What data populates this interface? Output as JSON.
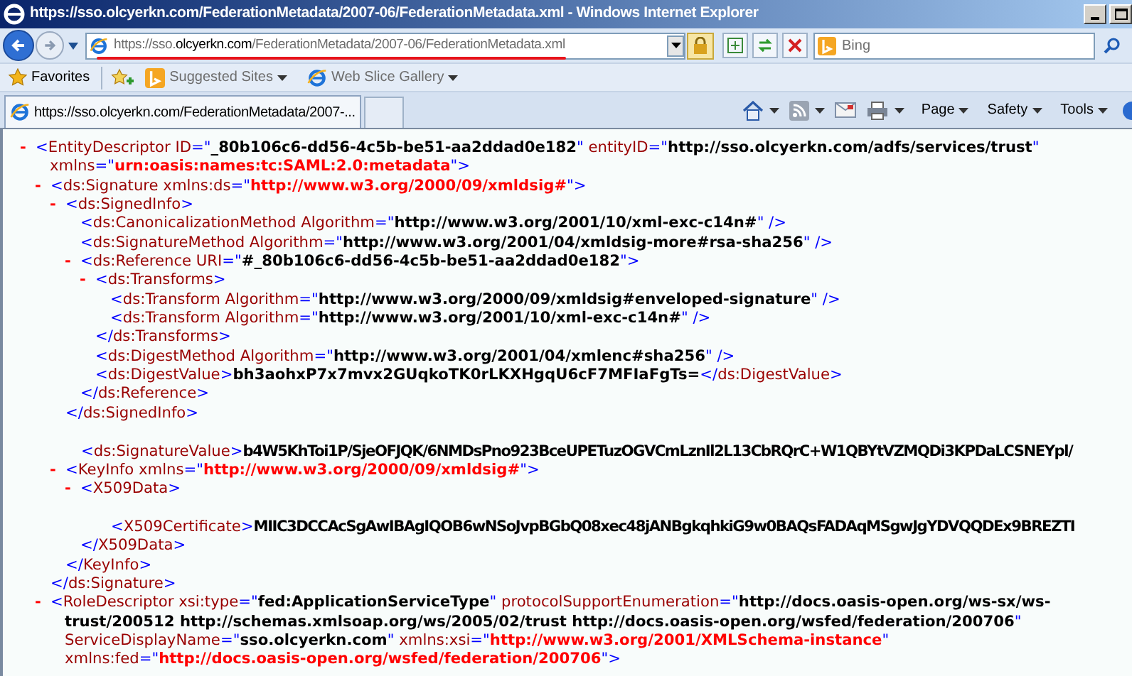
{
  "window": {
    "title": "https://sso.olcyerkn.com/FederationMetadata/2007-06/FederationMetadata.xml - Windows Internet Explorer"
  },
  "address_bar": {
    "url_parts": [
      {
        "text": "https://sso.",
        "emphasis": false
      },
      {
        "text": "olcyerkn.com",
        "emphasis": true
      },
      {
        "text": "/FederationMetadata/2007-06/FederationMetadata.xml",
        "emphasis": false
      }
    ]
  },
  "search": {
    "placeholder": "Bing"
  },
  "favorites_bar": {
    "favorites": "Favorites",
    "items": [
      {
        "label": "Suggested Sites"
      },
      {
        "label": "Web Slice Gallery"
      }
    ]
  },
  "tabs": [
    {
      "label": "https://sso.olcyerkn.com/FederationMetadata/2007-...",
      "selected": true
    }
  ],
  "command_bar": [
    "Page",
    "Safety",
    "Tools"
  ],
  "document": {
    "nodes": [
      {
        "kind": "element",
        "toggle": "-",
        "lines": [
          [
            {
              "kind": "p",
              "text": "<"
            },
            {
              "kind": "tag",
              "text": "EntityDescriptor"
            },
            {
              "kind": "attr",
              "text": " ID"
            },
            {
              "kind": "p",
              "text": "=\""
            },
            {
              "kind": "val",
              "text": "_80b106c6-dd56-4c5b-be51-aa2ddad0e182"
            },
            {
              "kind": "p",
              "text": "\""
            },
            {
              "kind": "attr",
              "text": " entityID"
            },
            {
              "kind": "p",
              "text": "=\""
            },
            {
              "kind": "val",
              "text": "http://sso.olcyerkn.com/adfs/services/trust"
            },
            {
              "kind": "p",
              "text": "\""
            }
          ],
          [
            {
              "kind": "attr",
              "text": "xmlns"
            },
            {
              "kind": "p",
              "text": "=\""
            },
            {
              "kind": "ns",
              "text": "urn:oasis:names:tc:SAML:2.0:metadata"
            },
            {
              "kind": "p",
              "text": "\">"
            }
          ]
        ],
        "children": [
          {
            "kind": "element",
            "toggle": "-",
            "lines": [
              [
                {
                  "kind": "p",
                  "text": "<"
                },
                {
                  "kind": "tag",
                  "text": "ds:Signature"
                },
                {
                  "kind": "attr",
                  "text": " xmlns:ds"
                },
                {
                  "kind": "p",
                  "text": "=\""
                },
                {
                  "kind": "ns",
                  "text": "http://www.w3.org/2000/09/xmldsig#"
                },
                {
                  "kind": "p",
                  "text": "\">"
                }
              ]
            ],
            "children": [
              {
                "kind": "element",
                "toggle": "-",
                "lines": [
                  [
                    {
                      "kind": "p",
                      "text": "<"
                    },
                    {
                      "kind": "tag",
                      "text": "ds:SignedInfo"
                    },
                    {
                      "kind": "p",
                      "text": ">"
                    }
                  ]
                ],
                "children": [
                  {
                    "kind": "leaf",
                    "lines": [
                      [
                        {
                          "kind": "p",
                          "text": "<"
                        },
                        {
                          "kind": "tag",
                          "text": "ds:CanonicalizationMethod"
                        },
                        {
                          "kind": "attr",
                          "text": " Algorithm"
                        },
                        {
                          "kind": "p",
                          "text": "=\""
                        },
                        {
                          "kind": "val",
                          "text": "http://www.w3.org/2001/10/xml-exc-c14n#"
                        },
                        {
                          "kind": "p",
                          "text": "\" />"
                        }
                      ]
                    ]
                  },
                  {
                    "kind": "leaf",
                    "lines": [
                      [
                        {
                          "kind": "p",
                          "text": "<"
                        },
                        {
                          "kind": "tag",
                          "text": "ds:SignatureMethod"
                        },
                        {
                          "kind": "attr",
                          "text": " Algorithm"
                        },
                        {
                          "kind": "p",
                          "text": "=\""
                        },
                        {
                          "kind": "val",
                          "text": "http://www.w3.org/2001/04/xmldsig-more#rsa-sha256"
                        },
                        {
                          "kind": "p",
                          "text": "\" />"
                        }
                      ]
                    ]
                  },
                  {
                    "kind": "element",
                    "toggle": "-",
                    "lines": [
                      [
                        {
                          "kind": "p",
                          "text": "<"
                        },
                        {
                          "kind": "tag",
                          "text": "ds:Reference"
                        },
                        {
                          "kind": "attr",
                          "text": " URI"
                        },
                        {
                          "kind": "p",
                          "text": "=\""
                        },
                        {
                          "kind": "val",
                          "text": "#_80b106c6-dd56-4c5b-be51-aa2ddad0e182"
                        },
                        {
                          "kind": "p",
                          "text": "\">"
                        }
                      ]
                    ],
                    "children": [
                      {
                        "kind": "element",
                        "toggle": "-",
                        "lines": [
                          [
                            {
                              "kind": "p",
                              "text": "<"
                            },
                            {
                              "kind": "tag",
                              "text": "ds:Transforms"
                            },
                            {
                              "kind": "p",
                              "text": ">"
                            }
                          ]
                        ],
                        "children": [
                          {
                            "kind": "leaf",
                            "lines": [
                              [
                                {
                                  "kind": "p",
                                  "text": "<"
                                },
                                {
                                  "kind": "tag",
                                  "text": "ds:Transform"
                                },
                                {
                                  "kind": "attr",
                                  "text": " Algorithm"
                                },
                                {
                                  "kind": "p",
                                  "text": "=\""
                                },
                                {
                                  "kind": "val",
                                  "text": "http://www.w3.org/2000/09/xmldsig#enveloped-signature"
                                },
                                {
                                  "kind": "p",
                                  "text": "\" />"
                                }
                              ]
                            ]
                          },
                          {
                            "kind": "leaf",
                            "lines": [
                              [
                                {
                                  "kind": "p",
                                  "text": "<"
                                },
                                {
                                  "kind": "tag",
                                  "text": "ds:Transform"
                                },
                                {
                                  "kind": "attr",
                                  "text": " Algorithm"
                                },
                                {
                                  "kind": "p",
                                  "text": "=\""
                                },
                                {
                                  "kind": "val",
                                  "text": "http://www.w3.org/2001/10/xml-exc-c14n#"
                                },
                                {
                                  "kind": "p",
                                  "text": "\" />"
                                }
                              ]
                            ]
                          }
                        ],
                        "close": [
                          {
                            "kind": "p",
                            "text": "</"
                          },
                          {
                            "kind": "tag",
                            "text": "ds:Transforms"
                          },
                          {
                            "kind": "p",
                            "text": ">"
                          }
                        ]
                      },
                      {
                        "kind": "leaf",
                        "lines": [
                          [
                            {
                              "kind": "p",
                              "text": "<"
                            },
                            {
                              "kind": "tag",
                              "text": "ds:DigestMethod"
                            },
                            {
                              "kind": "attr",
                              "text": " Algorithm"
                            },
                            {
                              "kind": "p",
                              "text": "=\""
                            },
                            {
                              "kind": "val",
                              "text": "http://www.w3.org/2001/04/xmlenc#sha256"
                            },
                            {
                              "kind": "p",
                              "text": "\" />"
                            }
                          ]
                        ]
                      },
                      {
                        "kind": "leaf",
                        "lines": [
                          [
                            {
                              "kind": "p",
                              "text": "<"
                            },
                            {
                              "kind": "tag",
                              "text": "ds:DigestValue"
                            },
                            {
                              "kind": "p",
                              "text": ">"
                            },
                            {
                              "kind": "val",
                              "text": "bh3aohxP7x7mvx2GUqkoTK0rLKXHgqU6cF7MFIaFgTs="
                            },
                            {
                              "kind": "p",
                              "text": "</"
                            },
                            {
                              "kind": "tag",
                              "text": "ds:DigestValue"
                            },
                            {
                              "kind": "p",
                              "text": ">"
                            }
                          ]
                        ]
                      }
                    ],
                    "close": [
                      {
                        "kind": "p",
                        "text": "</"
                      },
                      {
                        "kind": "tag",
                        "text": "ds:Reference"
                      },
                      {
                        "kind": "p",
                        "text": ">"
                      }
                    ]
                  }
                ],
                "close": [
                  {
                    "kind": "p",
                    "text": "</"
                  },
                  {
                    "kind": "tag",
                    "text": "ds:SignedInfo"
                  },
                  {
                    "kind": "p",
                    "text": ">"
                  }
                ]
              },
              {
                "kind": "text_element",
                "lines": [
                  [
                    {
                      "kind": "p",
                      "text": "<"
                    },
                    {
                      "kind": "tag",
                      "text": "ds:SignatureValue"
                    },
                    {
                      "kind": "p",
                      "text": ">"
                    },
                    {
                      "kind": "val",
                      "text": "b4W5KhToi1P/SjeOFJQK/6NMDsPno923BceUPETuzOGVCmLznIl2L13CbRQrC+W1QBYtVZMQDi3KPDaLCSNEYpl/"
                    }
                  ]
                ]
              },
              {
                "kind": "element",
                "toggle": "-",
                "lines": [
                  [
                    {
                      "kind": "p",
                      "text": "<"
                    },
                    {
                      "kind": "tag",
                      "text": "KeyInfo"
                    },
                    {
                      "kind": "attr",
                      "text": " xmlns"
                    },
                    {
                      "kind": "p",
                      "text": "=\""
                    },
                    {
                      "kind": "ns",
                      "text": "http://www.w3.org/2000/09/xmldsig#"
                    },
                    {
                      "kind": "p",
                      "text": "\">"
                    }
                  ]
                ],
                "children": [
                  {
                    "kind": "element",
                    "toggle": "-",
                    "lines": [
                      [
                        {
                          "kind": "p",
                          "text": "<"
                        },
                        {
                          "kind": "tag",
                          "text": "X509Data"
                        },
                        {
                          "kind": "p",
                          "text": ">"
                        }
                      ]
                    ],
                    "children": [
                      {
                        "kind": "text_element",
                        "lines": [
                          [
                            {
                              "kind": "p",
                              "text": "<"
                            },
                            {
                              "kind": "tag",
                              "text": "X509Certificate"
                            },
                            {
                              "kind": "p",
                              "text": ">"
                            },
                            {
                              "kind": "val",
                              "text": "MIIC3DCCAcSgAwIBAgIQOB6wNSoJvpBGbQ08xec48jANBgkqhkiG9w0BAQsFADAqMSgwJgYDVQQDEx9BREZTI"
                            }
                          ]
                        ]
                      }
                    ],
                    "close": [
                      {
                        "kind": "p",
                        "text": "</"
                      },
                      {
                        "kind": "tag",
                        "text": "X509Data"
                      },
                      {
                        "kind": "p",
                        "text": ">"
                      }
                    ]
                  }
                ],
                "close": [
                  {
                    "kind": "p",
                    "text": "</"
                  },
                  {
                    "kind": "tag",
                    "text": "KeyInfo"
                  },
                  {
                    "kind": "p",
                    "text": ">"
                  }
                ]
              }
            ],
            "close": [
              {
                "kind": "p",
                "text": "</"
              },
              {
                "kind": "tag",
                "text": "ds:Signature"
              },
              {
                "kind": "p",
                "text": ">"
              }
            ]
          },
          {
            "kind": "element",
            "toggle": "-",
            "lines": [
              [
                {
                  "kind": "p",
                  "text": "<"
                },
                {
                  "kind": "tag",
                  "text": "RoleDescriptor"
                },
                {
                  "kind": "attr",
                  "text": " xsi:type"
                },
                {
                  "kind": "p",
                  "text": "=\""
                },
                {
                  "kind": "val",
                  "text": "fed:ApplicationServiceType"
                },
                {
                  "kind": "p",
                  "text": "\""
                },
                {
                  "kind": "attr",
                  "text": " protocolSupportEnumeration"
                },
                {
                  "kind": "p",
                  "text": "=\""
                },
                {
                  "kind": "val",
                  "text": "http://docs.oasis-open.org/ws-sx/ws-"
                }
              ],
              [
                {
                  "kind": "val",
                  "text": "trust/200512 http://schemas.xmlsoap.org/ws/2005/02/trust http://docs.oasis-open.org/wsfed/federation/200706"
                },
                {
                  "kind": "p",
                  "text": "\""
                }
              ],
              [
                {
                  "kind": "attr",
                  "text": "ServiceDisplayName"
                },
                {
                  "kind": "p",
                  "text": "=\""
                },
                {
                  "kind": "val",
                  "text": "sso.olcyerkn.com"
                },
                {
                  "kind": "p",
                  "text": "\""
                },
                {
                  "kind": "attr",
                  "text": " xmlns:xsi"
                },
                {
                  "kind": "p",
                  "text": "=\""
                },
                {
                  "kind": "ns",
                  "text": "http://www.w3.org/2001/XMLSchema-instance"
                },
                {
                  "kind": "p",
                  "text": "\""
                }
              ],
              [
                {
                  "kind": "attr",
                  "text": "xmlns:fed"
                },
                {
                  "kind": "p",
                  "text": "=\""
                },
                {
                  "kind": "ns",
                  "text": "http://docs.oasis-open.org/wsfed/federation/200706"
                },
                {
                  "kind": "p",
                  "text": "\">"
                }
              ]
            ]
          }
        ]
      }
    ]
  }
}
